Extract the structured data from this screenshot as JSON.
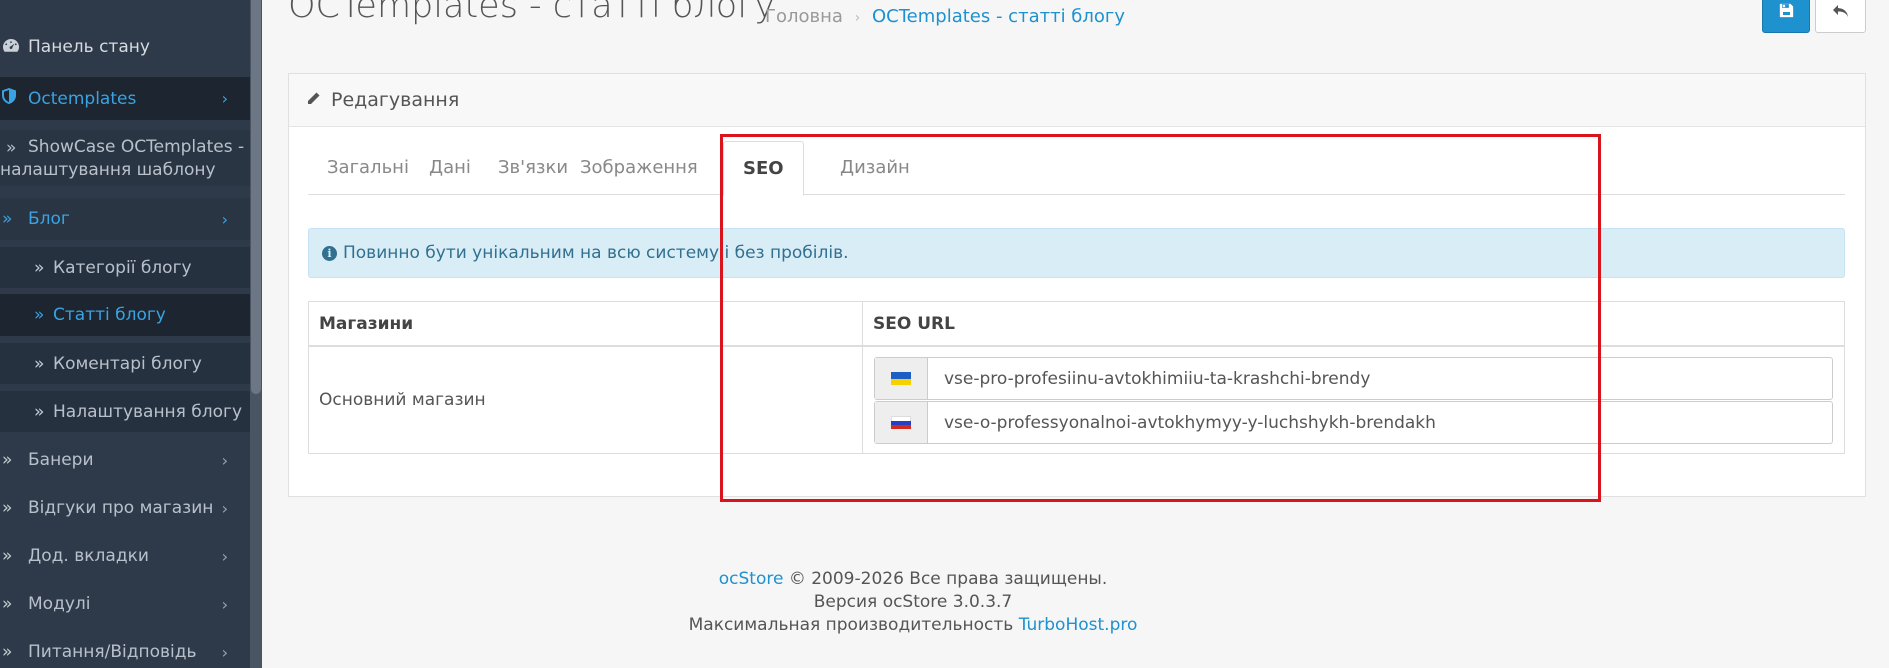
{
  "sidebar": {
    "items": [
      {
        "label": "Панель стану"
      },
      {
        "label": "Octemplates"
      },
      {
        "label": "ShowCase OCTemplates -",
        "label2": "налаштування шаблону"
      },
      {
        "label": "Блог"
      },
      {
        "label": "Категорії блогу"
      },
      {
        "label": "Статті блогу"
      },
      {
        "label": "Коментарі блогу"
      },
      {
        "label": "Налаштування блогу"
      },
      {
        "label": "Банери"
      },
      {
        "label": "Відгуки про магазин"
      },
      {
        "label": "Дод. вкладки"
      },
      {
        "label": "Модулі"
      },
      {
        "label": "Питання/Відповідь"
      }
    ]
  },
  "header": {
    "title": "OCTemplates - статті блогу",
    "breadcrumb": [
      "Головна",
      "OCTemplates - статті блогу"
    ]
  },
  "panel": {
    "heading": "Редагування",
    "tabs": [
      "Загальні",
      "Дані",
      "Зв'язки",
      "Зображення",
      "SEO",
      "Дизайн"
    ],
    "active_tab": "SEO",
    "alert": "Повинно бути унікальним на всю систему і без пробілів.",
    "table": {
      "headers": [
        "Магазини",
        "SEO URL"
      ],
      "store": "Основний магазин",
      "seo_urls": [
        {
          "lang": "uk",
          "value": "vse-pro-profesiinu-avtokhimiiu-ta-krashchi-brendy"
        },
        {
          "lang": "ru",
          "value": "vse-o-professyonalnoi-avtokhymyy-y-luchshykh-brendakh"
        }
      ]
    }
  },
  "footer": {
    "line1_link": "ocStore",
    "line1_text": "© 2009-2026 Все права защищены.",
    "line2": "Версия ocStore 3.0.3.7",
    "line3_text": "Максимальная производительность",
    "line3_link": "TurboHost.pro"
  },
  "colors": {
    "sidebar_bg": "#2e3a49",
    "accent": "#1e91cf",
    "highlight_border": "#d9141c"
  },
  "icons": {
    "dashboard": "dashboard-icon",
    "octemplates": "shield-icon",
    "edit": "pencil-icon",
    "info": "info-circle-icon",
    "save": "save-icon",
    "back": "reply-icon"
  }
}
